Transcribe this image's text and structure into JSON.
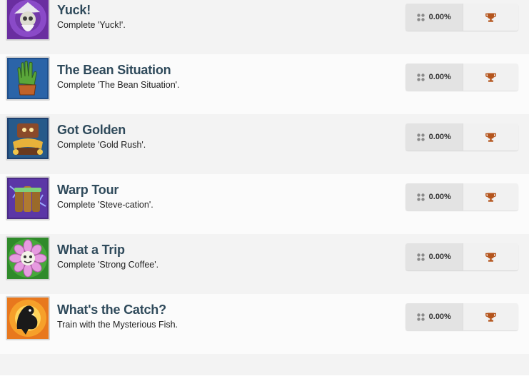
{
  "colors": {
    "title": "#2f4a5b",
    "trophy_bronze": "#b5551d",
    "row_alt": "#f3f3f3"
  },
  "achievements": [
    {
      "title": "Yuck!",
      "description": "Complete 'Yuck!'.",
      "percent": "0.00%",
      "icon": "zombie-wizard-icon",
      "trophy": "bronze-trophy-icon"
    },
    {
      "title": "The Bean Situation",
      "description": "Complete 'The Bean Situation'.",
      "percent": "0.00%",
      "icon": "green-glove-icon",
      "trophy": "bronze-trophy-icon"
    },
    {
      "title": "Got Golden",
      "description": "Complete 'Gold Rush'.",
      "percent": "0.00%",
      "icon": "gold-treasure-icon",
      "trophy": "bronze-trophy-icon"
    },
    {
      "title": "Warp Tour",
      "description": "Complete 'Steve-cation'.",
      "percent": "0.00%",
      "icon": "warp-pipes-icon",
      "trophy": "bronze-trophy-icon"
    },
    {
      "title": "What a Trip",
      "description": "Complete 'Strong Coffee'.",
      "percent": "0.00%",
      "icon": "pink-flower-icon",
      "trophy": "bronze-trophy-icon"
    },
    {
      "title": "What's the Catch?",
      "description": "Train with the Mysterious Fish.",
      "percent": "0.00%",
      "icon": "mysterious-fish-icon",
      "trophy": "bronze-trophy-icon"
    }
  ]
}
